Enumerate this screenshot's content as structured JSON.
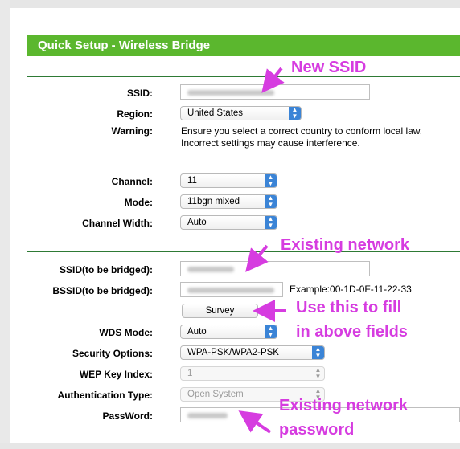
{
  "header": {
    "title": "Quick Setup - Wireless Bridge"
  },
  "wireless": {
    "ssid_label": "SSID:",
    "region_label": "Region:",
    "region_value": "United States",
    "warning_label": "Warning:",
    "warning_line1": "Ensure you select a correct country to conform local law.",
    "warning_line2": "Incorrect settings may cause interference.",
    "channel_label": "Channel:",
    "channel_value": "11",
    "mode_label": "Mode:",
    "mode_value": "11bgn mixed",
    "width_label": "Channel Width:",
    "width_value": "Auto"
  },
  "bridge": {
    "ssid_label": "SSID(to be bridged):",
    "bssid_label": "BSSID(to be bridged):",
    "bssid_example": "Example:00-1D-0F-11-22-33",
    "survey_label": "Survey",
    "wds_label": "WDS Mode:",
    "wds_value": "Auto",
    "security_label": "Security Options:",
    "security_value": "WPA-PSK/WPA2-PSK",
    "wep_label": "WEP Key Index:",
    "wep_value": "1",
    "auth_label": "Authentication Type:",
    "auth_value": "Open System",
    "password_label": "PassWord:"
  },
  "annotations": {
    "new_ssid": "New SSID",
    "existing_network": "Existing network",
    "use_this_line1": "Use this to fill",
    "use_this_line2": "in above fields",
    "existing_password_line1": "Existing network",
    "existing_password_line2": "password"
  },
  "colors": {
    "header": "#5bb72e",
    "annotation": "#d63ce0",
    "select_arrow": "#3b84d6"
  }
}
